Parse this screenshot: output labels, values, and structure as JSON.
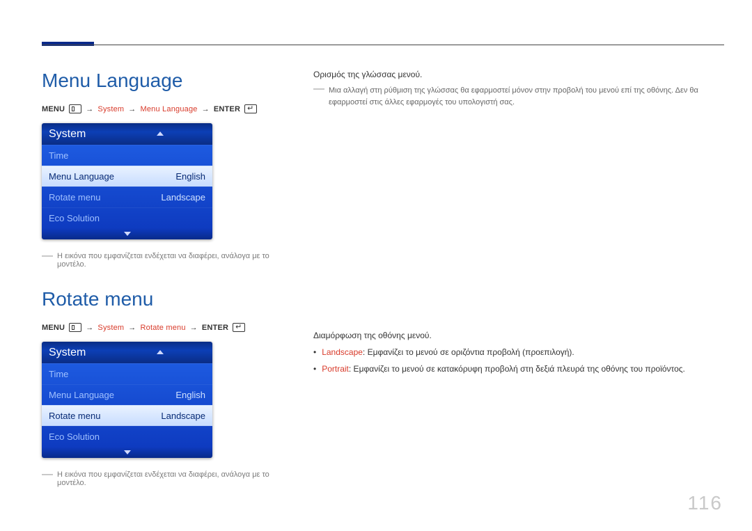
{
  "page_number": "116",
  "section1": {
    "title": "Menu Language",
    "breadcrumb": {
      "menu": "MENU",
      "system": "System",
      "item": "Menu Language",
      "enter": "ENTER"
    },
    "osd": {
      "header": "System",
      "rows": [
        {
          "label": "Time",
          "value": ""
        },
        {
          "label": "Menu Language",
          "value": "English",
          "selected": true
        },
        {
          "label": "Rotate menu",
          "value": "Landscape"
        },
        {
          "label": "Eco Solution",
          "value": ""
        }
      ]
    },
    "footnote": "Η εικόνα που εμφανίζεται ενδέχεται να διαφέρει, ανάλογα με το μοντέλο.",
    "rc_para": "Ορισμός της γλώσσας μενού.",
    "rc_note": "Μια αλλαγή στη ρύθμιση της γλώσσας θα εφαρμοστεί μόνον στην προβολή του μενού επί της οθόνης. Δεν θα εφαρμοστεί στις άλλες εφαρμογές του υπολογιστή σας."
  },
  "section2": {
    "title": "Rotate menu",
    "breadcrumb": {
      "menu": "MENU",
      "system": "System",
      "item": "Rotate menu",
      "enter": "ENTER"
    },
    "osd": {
      "header": "System",
      "rows": [
        {
          "label": "Time",
          "value": ""
        },
        {
          "label": "Menu Language",
          "value": "English"
        },
        {
          "label": "Rotate menu",
          "value": "Landscape",
          "selected": true
        },
        {
          "label": "Eco Solution",
          "value": ""
        }
      ]
    },
    "footnote": "Η εικόνα που εμφανίζεται ενδέχεται να διαφέρει, ανάλογα με το μοντέλο.",
    "rc_para": "Διαμόρφωση της οθόνης μενού.",
    "rc_items": [
      {
        "label": "Landscape",
        "text": ": Εμφανίζει το μενού σε οριζόντια προβολή (προεπιλογή)."
      },
      {
        "label": "Portrait",
        "text": ": Εμφανίζει το μενού σε κατακόρυφη προβολή στη δεξιά πλευρά της οθόνης του προϊόντος."
      }
    ]
  }
}
